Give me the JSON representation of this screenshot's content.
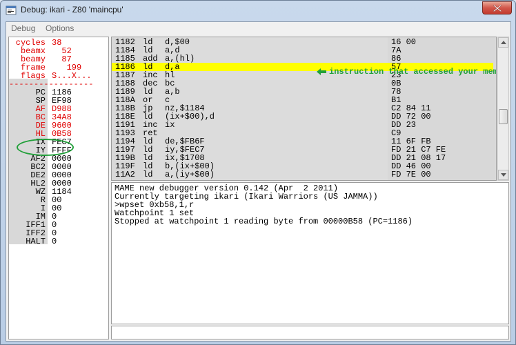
{
  "window": {
    "title": "Debug: ikari - Z80 'maincpu'",
    "icon": "mame-app-icon"
  },
  "menu": [
    "Debug",
    "Options"
  ],
  "registers_top": [
    {
      "name": "cycles",
      "value": "38"
    },
    {
      "name": "beamx",
      "value": "  52"
    },
    {
      "name": "beamy",
      "value": "  87"
    },
    {
      "name": "frame",
      "value": "   199"
    },
    {
      "name": "flags",
      "value": "S...X..."
    }
  ],
  "separator": "-----------------",
  "registers": [
    {
      "name": "PC",
      "value": "1186",
      "red": false
    },
    {
      "name": "SP",
      "value": "EF98",
      "red": false
    },
    {
      "name": "AF",
      "value": "D988",
      "red": true
    },
    {
      "name": "BC",
      "value": "34A8",
      "red": true
    },
    {
      "name": "DE",
      "value": "9600",
      "red": true
    },
    {
      "name": "HL",
      "value": "0B58",
      "red": true
    },
    {
      "name": "IX",
      "value": "FEC7",
      "red": false
    },
    {
      "name": "IY",
      "value": "FFFF",
      "red": false
    },
    {
      "name": "AF2",
      "value": "0000",
      "red": false
    },
    {
      "name": "BC2",
      "value": "0000",
      "red": false
    },
    {
      "name": "DE2",
      "value": "0000",
      "red": false
    },
    {
      "name": "HL2",
      "value": "0000",
      "red": false
    },
    {
      "name": "WZ",
      "value": "1184",
      "red": false
    },
    {
      "name": "R",
      "value": "00",
      "red": false
    },
    {
      "name": "I",
      "value": "00",
      "red": false
    },
    {
      "name": "IM",
      "value": "0",
      "red": false
    },
    {
      "name": "IFF1",
      "value": "0",
      "red": false
    },
    {
      "name": "IFF2",
      "value": "0",
      "red": false
    },
    {
      "name": "HALT",
      "value": "0",
      "red": false
    }
  ],
  "disassembly": [
    {
      "addr": "1182",
      "mnem": "ld",
      "ops": "d,$00",
      "bytes": "16 00"
    },
    {
      "addr": "1184",
      "mnem": "ld",
      "ops": "a,d",
      "bytes": "7A"
    },
    {
      "addr": "1185",
      "mnem": "add",
      "ops": "a,(hl)",
      "bytes": "86"
    },
    {
      "addr": "1186",
      "mnem": "ld",
      "ops": "d,a",
      "bytes": "57"
    },
    {
      "addr": "1187",
      "mnem": "inc",
      "ops": "hl",
      "bytes": "23"
    },
    {
      "addr": "1188",
      "mnem": "dec",
      "ops": "bc",
      "bytes": "0B"
    },
    {
      "addr": "1189",
      "mnem": "ld",
      "ops": "a,b",
      "bytes": "78"
    },
    {
      "addr": "118A",
      "mnem": "or",
      "ops": "c",
      "bytes": "B1"
    },
    {
      "addr": "118B",
      "mnem": "jp",
      "ops": "nz,$1184",
      "bytes": "C2 84 11"
    },
    {
      "addr": "118E",
      "mnem": "ld",
      "ops": "(ix+$00),d",
      "bytes": "DD 72 00"
    },
    {
      "addr": "1191",
      "mnem": "inc",
      "ops": "ix",
      "bytes": "DD 23"
    },
    {
      "addr": "1193",
      "mnem": "ret",
      "ops": "",
      "bytes": "C9"
    },
    {
      "addr": "1194",
      "mnem": "ld",
      "ops": "de,$FB6F",
      "bytes": "11 6F FB"
    },
    {
      "addr": "1197",
      "mnem": "ld",
      "ops": "iy,$FEC7",
      "bytes": "FD 21 C7 FE"
    },
    {
      "addr": "119B",
      "mnem": "ld",
      "ops": "ix,$1708",
      "bytes": "DD 21 08 17"
    },
    {
      "addr": "119F",
      "mnem": "ld",
      "ops": "b,(ix+$00)",
      "bytes": "DD 46 00"
    },
    {
      "addr": "11A2",
      "mnem": "ld",
      "ops": "a,(iy+$00)",
      "bytes": "FD 7E 00"
    }
  ],
  "current_row_index": 3,
  "annotation": "instruction that accessed your memory",
  "console": [
    "MAME new debugger version 0.142 (Apr  2 2011)",
    "Currently targeting ikari (Ikari Warriors (US JAMMA))",
    ">wpset 0xb58,1,r",
    "Watchpoint 1 set",
    "Stopped at watchpoint 1 reading byte from 00000B58 (PC=1186)"
  ],
  "command_input": {
    "value": ""
  },
  "colors": {
    "highlight": "#ffff00",
    "annotation": "#22a03a",
    "register_changed": "#e00000"
  }
}
